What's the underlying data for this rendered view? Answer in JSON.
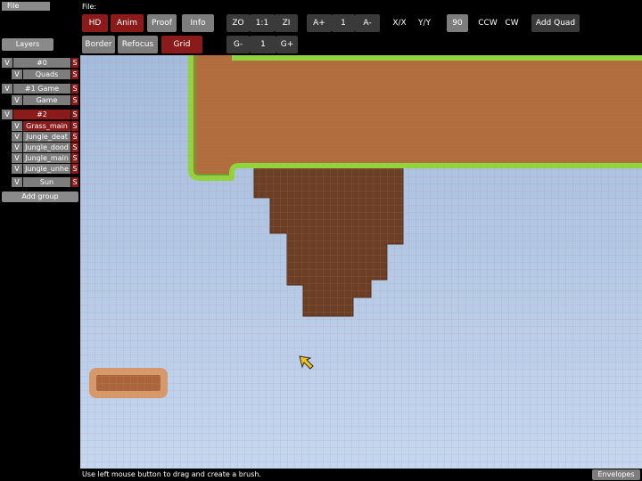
{
  "menu": {
    "file_button": "File",
    "file_label": "File:"
  },
  "toolbar": {
    "hd": "HD",
    "anim": "Anim",
    "proof": "Proof",
    "info": "Info",
    "zoom_out": "ZO",
    "zoom_reset": "1:1",
    "zoom_in": "ZI",
    "anim_faster": "A+",
    "anim_speed": "1",
    "anim_slower": "A-",
    "flip_x": "X/X",
    "flip_y": "Y/Y",
    "rotate_90": "90",
    "ccw": "CCW",
    "cw": "CW",
    "add_quad": "Add Quad",
    "border": "Border",
    "refocus": "Refocus",
    "grid": "Grid",
    "grid_smaller": "G-",
    "grid_factor": "1",
    "grid_bigger": "G+"
  },
  "sidebar": {
    "layers_button": "Layers",
    "groups": [
      {
        "vis": "V",
        "name": "#0",
        "s": "S",
        "selected": false,
        "layers": [
          {
            "vis": "V",
            "name": "Quads",
            "s": "S"
          }
        ]
      },
      {
        "vis": "V",
        "name": "#1 Game",
        "s": "S",
        "selected": false,
        "layers": [
          {
            "vis": "V",
            "name": "Game",
            "s": "S"
          }
        ]
      },
      {
        "vis": "V",
        "name": "#2",
        "s": "S",
        "selected": true,
        "layers": [
          {
            "vis": "V",
            "name": "Grass_main",
            "s": "S",
            "selected": true
          },
          {
            "vis": "V",
            "name": "Jungle_deat",
            "s": "S"
          },
          {
            "vis": "V",
            "name": "Jungle_dood",
            "s": "S"
          },
          {
            "vis": "V",
            "name": "Jungle_main",
            "s": "S"
          },
          {
            "vis": "V",
            "name": "Jungle_unhe",
            "s": "S"
          },
          {
            "vis": "V",
            "name": "Sun",
            "s": "S"
          }
        ]
      }
    ],
    "add_group": "Add group"
  },
  "status": {
    "text": "Use left mouse button to drag and create a brush.",
    "envelopes": "Envelopes"
  },
  "colors": {
    "button_active": "#8b1a1a",
    "button_idle": "#7d7d7d",
    "sky_top": "#a2bcdc",
    "sky_bottom": "#c3d7ef",
    "dirt": "#b06e3c",
    "dirt_dark": "#6b3f24",
    "grass": "#8fd63a",
    "grid_line": "#e07a8a",
    "cursor": "#f2c21a"
  }
}
